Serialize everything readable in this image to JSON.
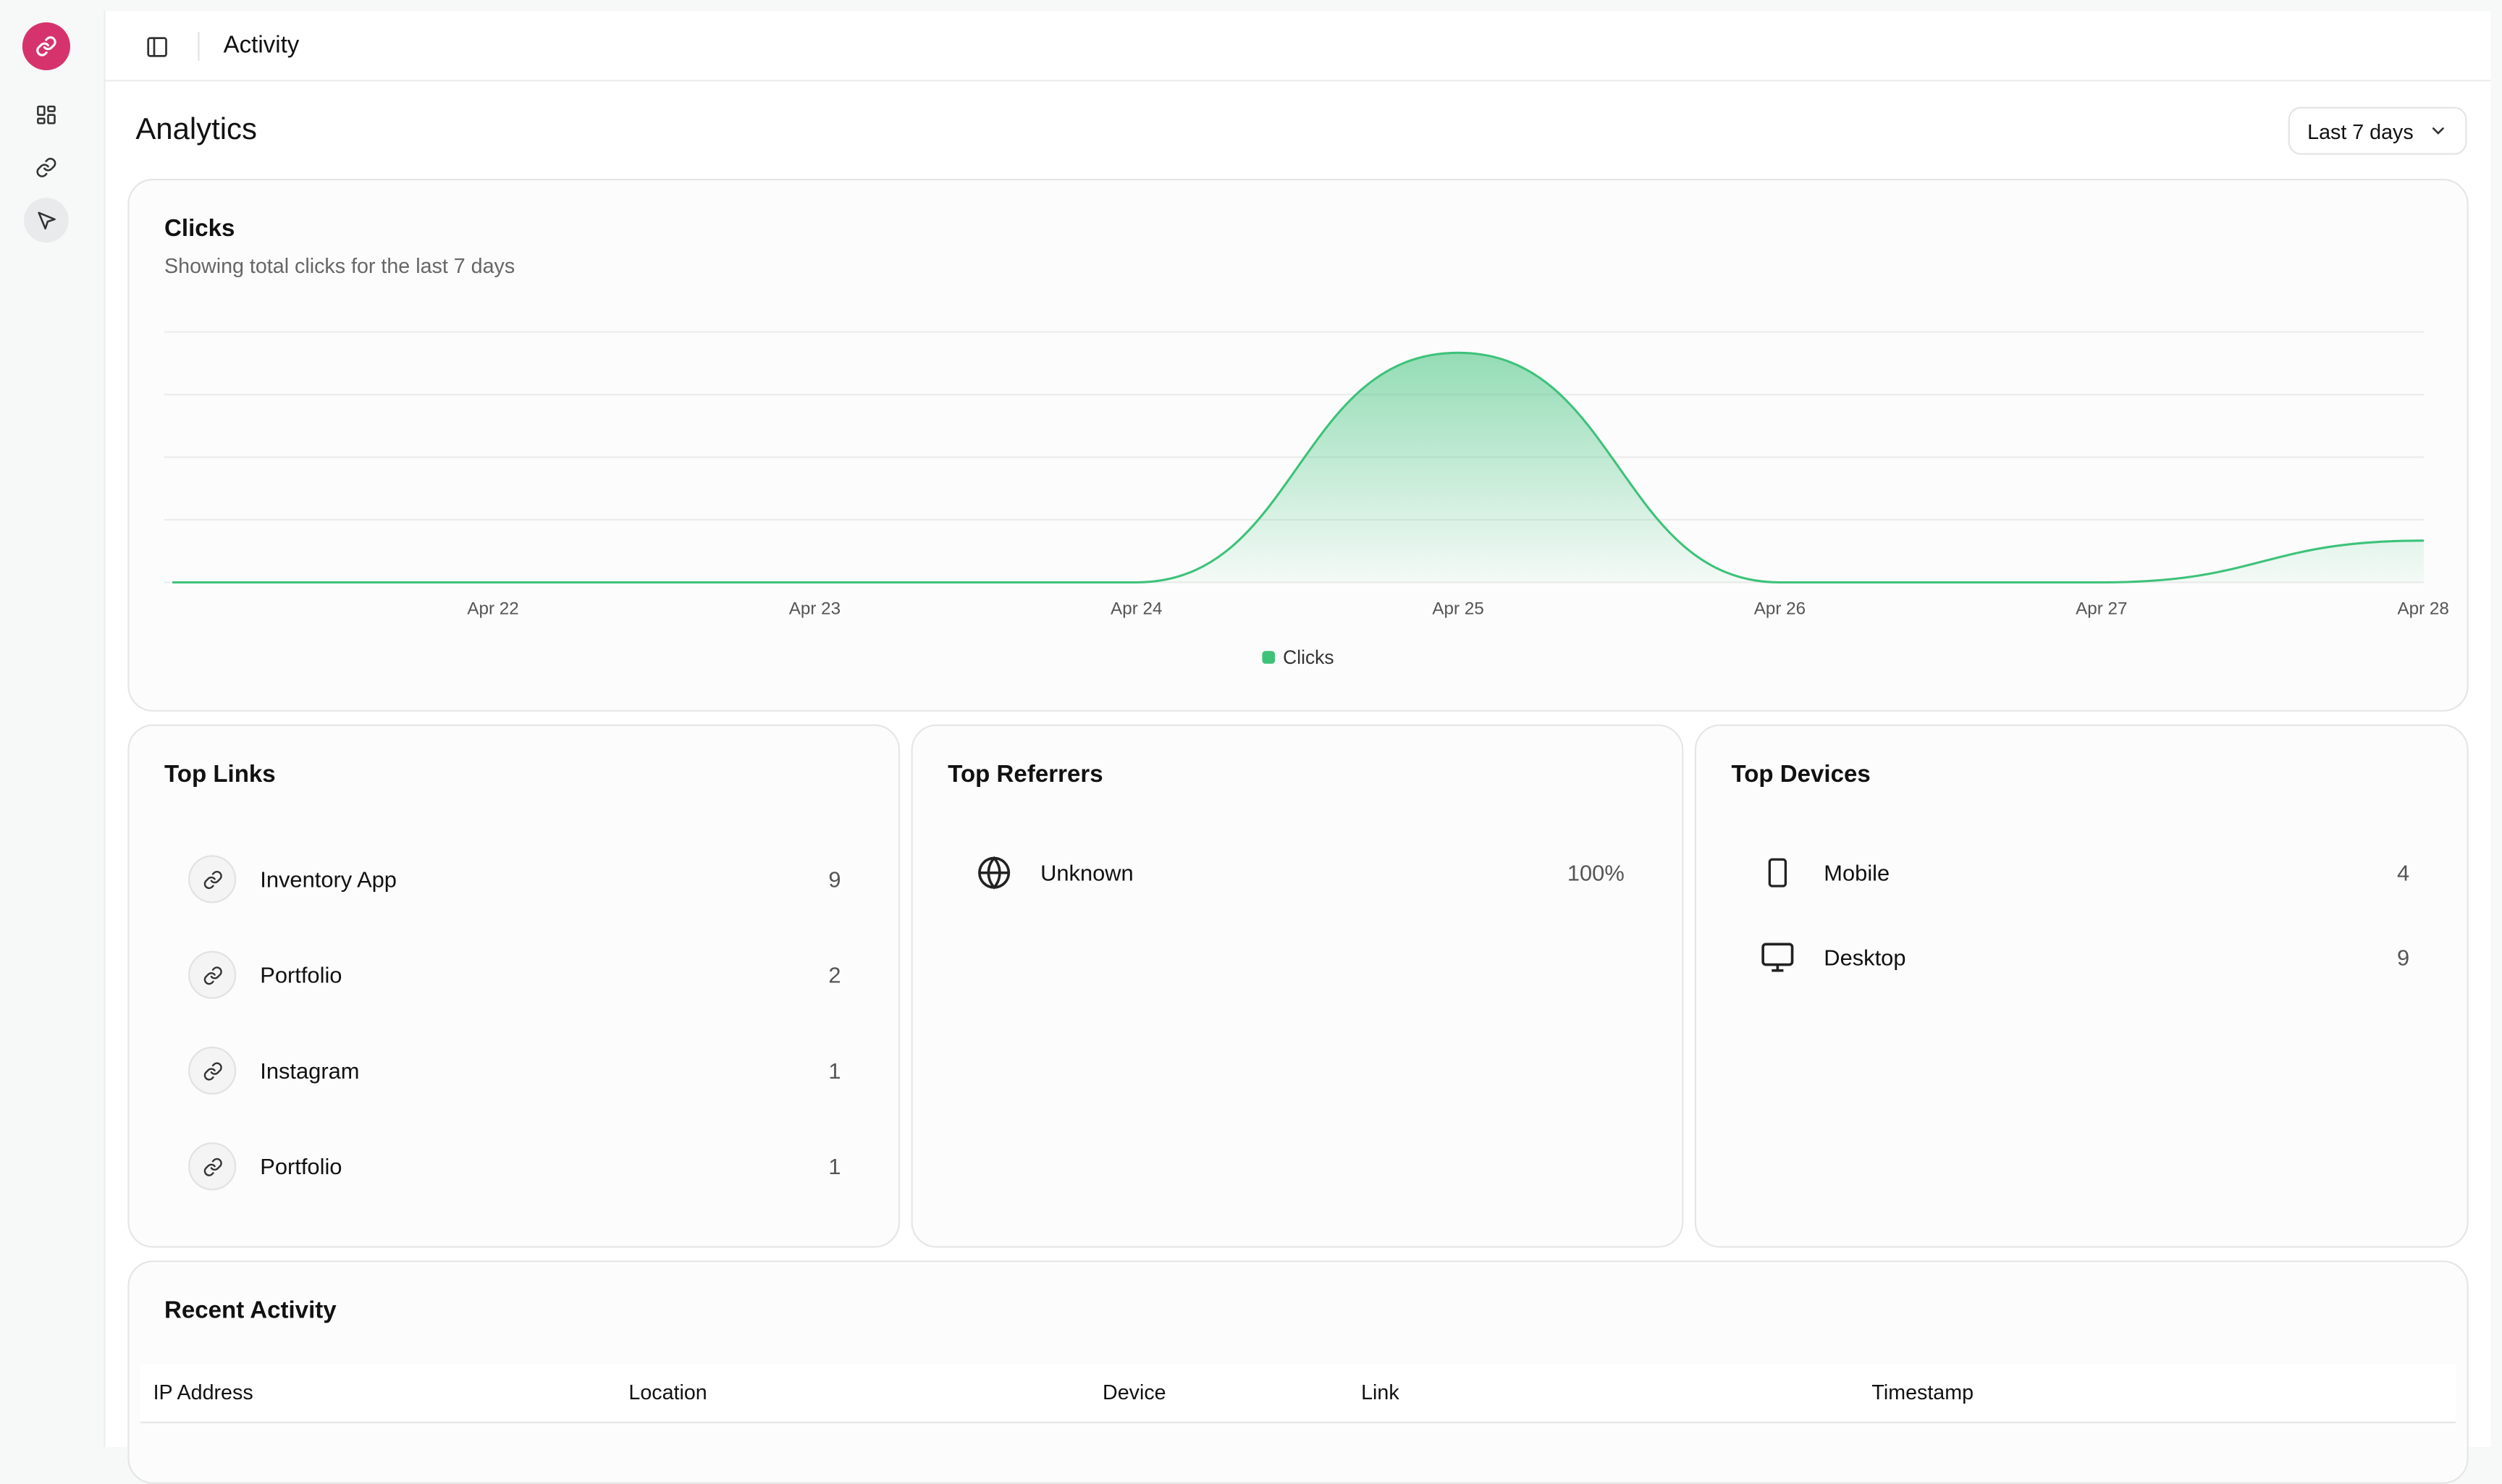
{
  "header": {
    "breadcrumb": "Activity"
  },
  "page": {
    "title": "Analytics",
    "range": "Last 7 days"
  },
  "clicks_card": {
    "title": "Clicks",
    "description": "Showing total clicks for the last 7 days",
    "legend": "Clicks"
  },
  "chart_data": {
    "type": "area",
    "x": [
      "Apr 22",
      "Apr 23",
      "Apr 24",
      "Apr 25",
      "Apr 26",
      "Apr 27",
      "Apr 28"
    ],
    "series": [
      {
        "name": "Clicks",
        "values": [
          0,
          0,
          0,
          11,
          0,
          0,
          2
        ]
      }
    ],
    "ylim": [
      0,
      12
    ],
    "grid": true,
    "legend": "bottom-center",
    "color": "#3ec27a"
  },
  "top_links": {
    "title": "Top Links",
    "items": [
      {
        "label": "Inventory App",
        "value": "9"
      },
      {
        "label": "Portfolio",
        "value": "2"
      },
      {
        "label": "Instagram",
        "value": "1"
      },
      {
        "label": "Portfolio",
        "value": "1"
      }
    ]
  },
  "top_referrers": {
    "title": "Top Referrers",
    "items": [
      {
        "label": "Unknown",
        "value": "100%",
        "icon": "globe-icon"
      }
    ]
  },
  "top_devices": {
    "title": "Top Devices",
    "items": [
      {
        "label": "Mobile",
        "value": "4",
        "icon": "mobile-icon"
      },
      {
        "label": "Desktop",
        "value": "9",
        "icon": "desktop-icon"
      }
    ]
  },
  "recent_activity": {
    "title": "Recent Activity",
    "columns": [
      "IP Address",
      "Location",
      "Device",
      "Link",
      "Timestamp"
    ]
  },
  "colors": {
    "brand": "#d6336c",
    "accent": "#3ec27a"
  }
}
